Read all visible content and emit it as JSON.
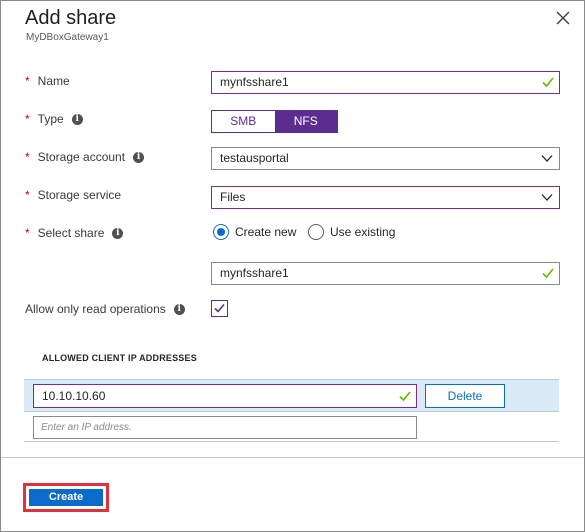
{
  "header": {
    "title": "Add share",
    "subtitle": "MyDBoxGateway1"
  },
  "form": {
    "required_marker": "*",
    "name": {
      "label": "Name",
      "value": "mynfsshare1"
    },
    "type": {
      "label": "Type",
      "options": [
        "SMB",
        "NFS"
      ],
      "selected": "NFS"
    },
    "storage_account": {
      "label": "Storage account",
      "value": "testausportal"
    },
    "storage_service": {
      "label": "Storage service",
      "value": "Files"
    },
    "select_share": {
      "label": "Select share",
      "options": [
        "Create new",
        "Use existing"
      ],
      "selected": "Create new",
      "share_name": "mynfsshare1"
    },
    "read_only": {
      "label": "Allow only read operations",
      "checked": true
    }
  },
  "allowed_ips": {
    "title": "ALLOWED CLIENT IP ADDRESSES",
    "entries": [
      "10.10.10.60"
    ],
    "delete_label": "Delete",
    "placeholder": "Enter an IP address."
  },
  "footer": {
    "create_label": "Create"
  },
  "colors": {
    "accent_purple": "#5c2d91",
    "accent_blue": "#0b6bcb",
    "valid_green": "#6bb700",
    "highlight_red": "#e0323c",
    "row_highlight": "#daeaf7"
  },
  "icons": {
    "close": "close-icon",
    "info": "info-icon",
    "valid": "checkmark-icon",
    "dropdown": "chevron-down-icon"
  }
}
